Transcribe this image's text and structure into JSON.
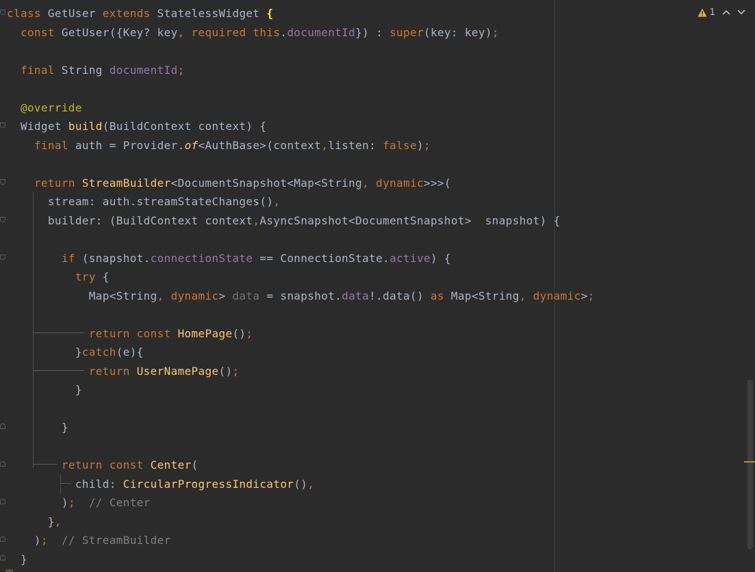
{
  "editor": {
    "status": {
      "warning_count": "1",
      "warning_icon": "warning-triangle-icon",
      "prev_icon": "chevron-up-icon",
      "next_icon": "chevron-down-icon",
      "warning_color": "#e3b341"
    },
    "colors": {
      "background": "#2b2b2b",
      "keyword": "#cc7832",
      "function": "#ffc66d",
      "field": "#9876aa",
      "annotation": "#bbb529",
      "comment": "#808080",
      "text": "#a9b7c6"
    },
    "lines": [
      [
        {
          "c": "k",
          "v": "class"
        },
        {
          "c": "t",
          "v": " GetUser "
        },
        {
          "c": "k",
          "v": "extends"
        },
        {
          "c": "t",
          "v": " StatelessWidget "
        },
        {
          "c": "br",
          "v": "{"
        }
      ],
      [
        {
          "c": "t",
          "v": "  "
        },
        {
          "c": "k",
          "v": "const"
        },
        {
          "c": "t",
          "v": " GetUser({Key? key"
        },
        {
          "c": "k",
          "v": ", required this"
        },
        {
          "c": "t",
          "v": "."
        },
        {
          "c": "fi",
          "v": "documentId"
        },
        {
          "c": "t",
          "v": "}) : "
        },
        {
          "c": "k",
          "v": "super"
        },
        {
          "c": "t",
          "v": "(key: key)"
        },
        {
          "c": "k",
          "v": ";"
        }
      ],
      [],
      [
        {
          "c": "t",
          "v": "  "
        },
        {
          "c": "k",
          "v": "final"
        },
        {
          "c": "t",
          "v": " String "
        },
        {
          "c": "fi",
          "v": "documentId"
        },
        {
          "c": "k",
          "v": ";"
        }
      ],
      [],
      [
        {
          "c": "t",
          "v": "  "
        },
        {
          "c": "an",
          "v": "@override"
        }
      ],
      [
        {
          "c": "t",
          "v": "  Widget "
        },
        {
          "c": "f",
          "v": "build"
        },
        {
          "c": "t",
          "v": "(BuildContext context) {"
        }
      ],
      [
        {
          "c": "t",
          "v": "    "
        },
        {
          "c": "k",
          "v": "final"
        },
        {
          "c": "t",
          "v": " auth = Provider."
        },
        {
          "c": "st",
          "v": "of"
        },
        {
          "c": "t",
          "v": "<AuthBase>(context"
        },
        {
          "c": "k",
          "v": ","
        },
        {
          "c": "t",
          "v": "listen: "
        },
        {
          "c": "k",
          "v": "false"
        },
        {
          "c": "t",
          "v": ")"
        },
        {
          "c": "k",
          "v": ";"
        }
      ],
      [],
      [
        {
          "c": "t",
          "v": "    "
        },
        {
          "c": "k",
          "v": "return"
        },
        {
          "c": "t",
          "v": " "
        },
        {
          "c": "f",
          "v": "StreamBuilder"
        },
        {
          "c": "t",
          "v": "<DocumentSnapshot<Map<String"
        },
        {
          "c": "k",
          "v": ", dynamic"
        },
        {
          "c": "t",
          "v": ">>>("
        }
      ],
      [
        {
          "c": "t",
          "v": "      stream: auth.streamStateChanges()"
        },
        {
          "c": "k",
          "v": ","
        }
      ],
      [
        {
          "c": "t",
          "v": "      builder: (BuildContext context"
        },
        {
          "c": "k",
          "v": ","
        },
        {
          "c": "t",
          "v": "AsyncSnapshot<DocumentSnapshot>  snapshot) {"
        }
      ],
      [],
      [
        {
          "c": "t",
          "v": "        "
        },
        {
          "c": "k",
          "v": "if"
        },
        {
          "c": "t",
          "v": " (snapshot."
        },
        {
          "c": "fi",
          "v": "connectionState"
        },
        {
          "c": "t",
          "v": " == ConnectionState."
        },
        {
          "c": "fi",
          "v": "active"
        },
        {
          "c": "t",
          "v": ") {"
        }
      ],
      [
        {
          "c": "t",
          "v": "          "
        },
        {
          "c": "k",
          "v": "try"
        },
        {
          "c": "t",
          "v": " {"
        }
      ],
      [
        {
          "c": "t",
          "v": "            Map<String"
        },
        {
          "c": "k",
          "v": ", dynamic"
        },
        {
          "c": "t",
          "v": "> "
        },
        {
          "c": "un",
          "v": "data"
        },
        {
          "c": "t",
          "v": " = snapshot."
        },
        {
          "c": "fi",
          "v": "data"
        },
        {
          "c": "t",
          "v": "!.data() "
        },
        {
          "c": "k",
          "v": "as"
        },
        {
          "c": "t",
          "v": " Map<String"
        },
        {
          "c": "k",
          "v": ", dynamic"
        },
        {
          "c": "t",
          "v": ">"
        },
        {
          "c": "k",
          "v": ";"
        }
      ],
      [],
      [
        {
          "c": "t",
          "v": "            "
        },
        {
          "c": "k",
          "v": "return const"
        },
        {
          "c": "t",
          "v": " "
        },
        {
          "c": "f",
          "v": "HomePage"
        },
        {
          "c": "t",
          "v": "()"
        },
        {
          "c": "k",
          "v": ";"
        }
      ],
      [
        {
          "c": "t",
          "v": "          }"
        },
        {
          "c": "k",
          "v": "catch"
        },
        {
          "c": "t",
          "v": "(e){"
        }
      ],
      [
        {
          "c": "t",
          "v": "            "
        },
        {
          "c": "k",
          "v": "return"
        },
        {
          "c": "t",
          "v": " "
        },
        {
          "c": "f",
          "v": "UserNamePage"
        },
        {
          "c": "t",
          "v": "()"
        },
        {
          "c": "k",
          "v": ";"
        }
      ],
      [
        {
          "c": "t",
          "v": "          }"
        }
      ],
      [],
      [
        {
          "c": "t",
          "v": "        }"
        }
      ],
      [],
      [
        {
          "c": "t",
          "v": "        "
        },
        {
          "c": "k",
          "v": "return const"
        },
        {
          "c": "t",
          "v": " "
        },
        {
          "c": "f",
          "v": "Center"
        },
        {
          "c": "t",
          "v": "("
        }
      ],
      [
        {
          "c": "t",
          "v": "          child: "
        },
        {
          "c": "f",
          "v": "CircularProgressIndicator"
        },
        {
          "c": "t",
          "v": "()"
        },
        {
          "c": "k",
          "v": ","
        }
      ],
      [
        {
          "c": "t",
          "v": "        )"
        },
        {
          "c": "k",
          "v": ";"
        },
        {
          "c": "t",
          "v": "  "
        },
        {
          "c": "c",
          "v": "// Center"
        }
      ],
      [
        {
          "c": "t",
          "v": "      }"
        },
        {
          "c": "k",
          "v": ","
        }
      ],
      [
        {
          "c": "t",
          "v": "    )"
        },
        {
          "c": "k",
          "v": ";"
        },
        {
          "c": "t",
          "v": "  "
        },
        {
          "c": "c",
          "v": "// StreamBuilder"
        }
      ],
      [
        {
          "c": "t",
          "v": "  }"
        }
      ]
    ]
  }
}
